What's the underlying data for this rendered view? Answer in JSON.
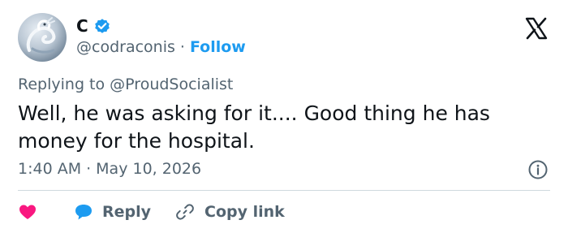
{
  "author": {
    "display_name": "C",
    "handle": "@codraconis",
    "separator": "·",
    "follow_label": "Follow",
    "verified": true
  },
  "reply_context": {
    "prefix": "Replying to",
    "mention": "@ProudSocialist"
  },
  "tweet": {
    "text": "Well, he was asking for it.... Good thing he has money for the hospital."
  },
  "meta": {
    "time": "1:40 AM",
    "separator": "·",
    "date": "May 10, 2026"
  },
  "actions": {
    "reply_label": "Reply",
    "copy_link_label": "Copy link"
  },
  "icons": {
    "verified": "verified-badge-icon",
    "platform": "x-logo-icon",
    "info": "info-icon",
    "like": "heart-icon",
    "reply": "reply-bubble-icon",
    "copy_link": "link-icon"
  },
  "colors": {
    "accent": "#1d9bf0",
    "like": "#f91880",
    "text_primary": "#0f1419",
    "text_secondary": "#536471",
    "divider": "#cfd9de"
  }
}
